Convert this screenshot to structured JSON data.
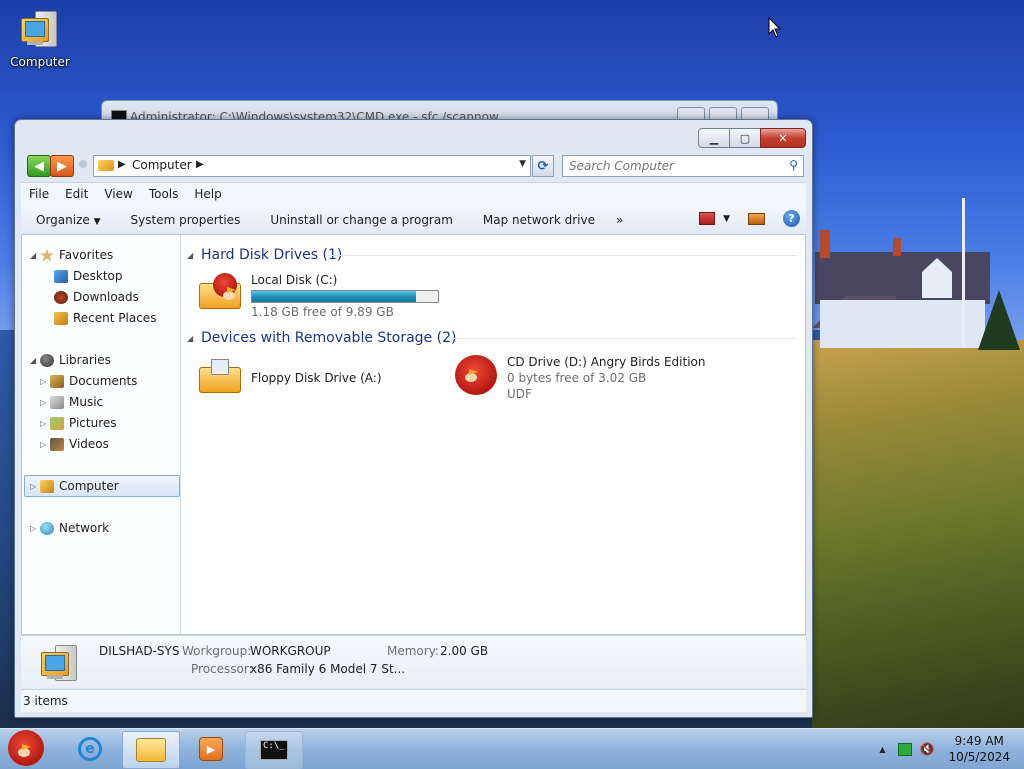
{
  "desktop": {
    "icon_label": "Computer",
    "icon_name": "computer-icon"
  },
  "cmd_window": {
    "title": "Administrator: C:\\Windows\\system32\\CMD.exe - sfc /scannow"
  },
  "explorer": {
    "address": {
      "breadcrumb": "Computer",
      "icon": "computer-icon"
    },
    "search": {
      "placeholder": "Search Computer"
    },
    "menu": [
      "File",
      "Edit",
      "View",
      "Tools",
      "Help"
    ],
    "commands": {
      "organize": "Organize",
      "system_properties": "System properties",
      "uninstall": "Uninstall or change a program",
      "map_drive": "Map network drive",
      "more": "»"
    },
    "nav": {
      "favorites": {
        "label": "Favorites",
        "items": [
          "Desktop",
          "Downloads",
          "Recent Places"
        ]
      },
      "libraries": {
        "label": "Libraries",
        "items": [
          "Documents",
          "Music",
          "Pictures",
          "Videos"
        ]
      },
      "computer": "Computer",
      "network": "Network"
    },
    "groups": {
      "hard_disks": {
        "title": "Hard Disk Drives (1)",
        "drives": [
          {
            "name": "Local Disk (C:)",
            "free": "1.18 GB free of 9.89 GB",
            "used_fraction": 0.88
          }
        ]
      },
      "removable": {
        "title": "Devices with Removable Storage (2)",
        "drives": [
          {
            "name": "Floppy Disk Drive (A:)"
          },
          {
            "name": "CD Drive (D:) Angry Birds Edition",
            "free": "0 bytes free of 3.02 GB",
            "fs": "UDF"
          }
        ]
      }
    },
    "details": {
      "computer_name": "DILSHAD-SYS",
      "workgroup_label": "Workgroup:",
      "workgroup": "WORKGROUP",
      "memory_label": "Memory:",
      "memory": "2.00 GB",
      "processor_label": "Processor:",
      "processor": "x86 Family 6 Model 7 St..."
    },
    "status": "3 items"
  },
  "taskbar": {
    "clock_time": "9:49 AM",
    "clock_date": "10/5/2024",
    "tray_up": "▲",
    "colors": {
      "accent": "#1e5fae",
      "close": "#c4412f"
    }
  }
}
